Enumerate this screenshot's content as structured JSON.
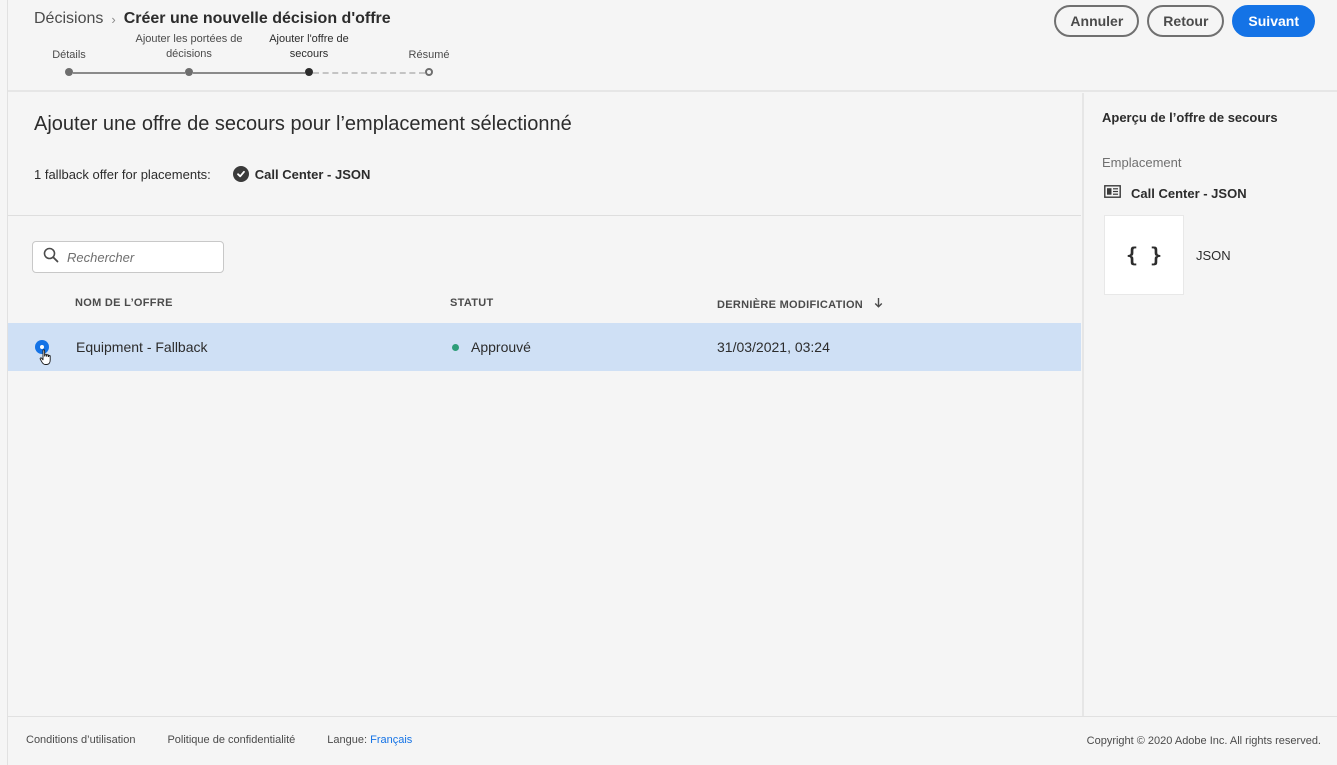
{
  "header": {
    "breadcrumb_root": "Décisions",
    "breadcrumb_separator": "›",
    "breadcrumb_current": "Créer une nouvelle décision d'offre",
    "steps": [
      {
        "label": "Détails",
        "state": "done"
      },
      {
        "label": "Ajouter les portées de décisions",
        "state": "done"
      },
      {
        "label": "Ajouter l'offre de secours",
        "state": "active"
      },
      {
        "label": "Résumé",
        "state": "todo"
      }
    ],
    "buttons": {
      "cancel": "Annuler",
      "back": "Retour",
      "next": "Suivant"
    }
  },
  "main": {
    "title": "Ajouter une offre de secours pour l’emplacement sélectionné",
    "fallback_count_text": "1 fallback offer for placements:",
    "placement": "Call Center - JSON",
    "search_placeholder": "Rechercher",
    "columns": {
      "name": "NOM DE L’OFFRE",
      "status": "STATUT",
      "modified": "DERNIÈRE MODIFICATION"
    },
    "sort_icon": "arrow-down-icon",
    "rows": [
      {
        "name": "Equipment - Fallback",
        "status": "Approuvé",
        "modified": "31/03/2021, 03:24",
        "selected": true
      }
    ]
  },
  "preview": {
    "title": "Aperçu de l’offre de secours",
    "placement_label": "Emplacement",
    "placement_name": "Call Center - JSON",
    "card_glyph": "{ }",
    "format": "JSON"
  },
  "footer": {
    "terms": "Conditions d’utilisation",
    "privacy": "Politique de confidentialité",
    "language_label": "Langue:",
    "language_value": "Français",
    "copyright": "Copyright © 2020 Adobe Inc. All rights reserved."
  },
  "colors": {
    "accent": "#1473e6",
    "selected_row": "#cfe0f5",
    "status_approved": "#2d9d78"
  }
}
